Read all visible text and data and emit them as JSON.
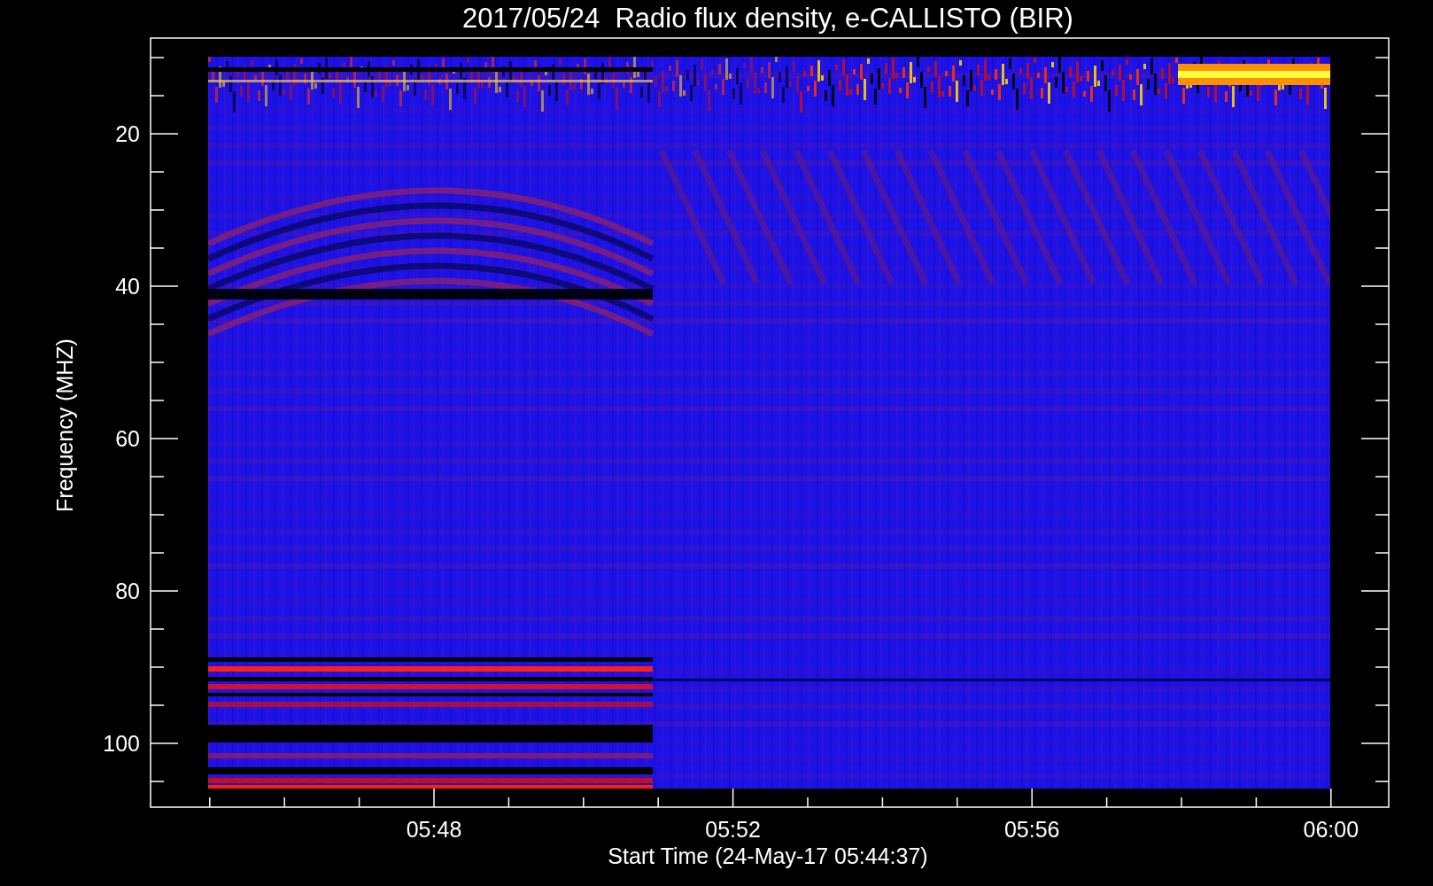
{
  "plot": {
    "title": "2017/05/24  Radio flux density, e-CALLISTO (BIR)",
    "ylabel": "Frequency (MHZ)",
    "xlabel": "Start Time (24-May-17 05:44:37)",
    "yticks": [
      "20",
      "40",
      "60",
      "80",
      "100"
    ],
    "xticks": [
      "05:48",
      "05:52",
      "05:56",
      "06:00"
    ]
  }
}
